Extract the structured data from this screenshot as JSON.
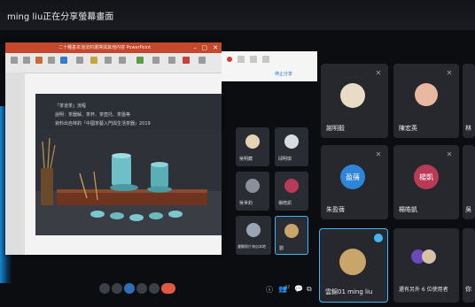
{
  "banner": {
    "text": "ming liu正在分享螢幕畫面"
  },
  "ppt": {
    "title": "二十種基本泡法的選擇與其他內容 PowerPoint",
    "slide": {
      "line1": "「茶道茶」流程",
      "line2": "說明：茶器解、茶杯、茶壺托、茶盤等",
      "line3": "資料出自林鈞『中國茶藝入門與生活茶器』2019"
    }
  },
  "share": {
    "stop_label": "停止分享"
  },
  "mid_tiles": [
    {
      "name": "吳明藏"
    },
    {
      "name": "邱明琪"
    },
    {
      "name": "吳世鈞"
    },
    {
      "name": "石峯源"
    },
    {
      "name": "盈倩"
    },
    {
      "name": "楊皓凱"
    },
    {
      "name": "盧顯照片來自本地"
    },
    {
      "name": "劉"
    }
  ],
  "tiles": [
    {
      "name": "謝明毅"
    },
    {
      "name": "陳宏英"
    },
    {
      "name": "林"
    },
    {
      "name": "朱盈蒨",
      "initials": "盈蒨",
      "color": "#2f86d8"
    },
    {
      "name": "楊皓凱",
      "initials": "楊凱",
      "color": "#b83a57"
    },
    {
      "name": "吳"
    },
    {
      "name": "雲錦01 ming liu"
    },
    {
      "name": "還有另外 6 位使用者"
    },
    {
      "name": "你"
    }
  ],
  "toolbar": {
    "icons": [
      "mic-icon",
      "camera-icon",
      "cc-icon",
      "hand-icon",
      "present-icon",
      "end-call-icon"
    ],
    "side_icons": [
      "info-icon",
      "people-icon",
      "chat-icon",
      "activities-icon"
    ],
    "people_count": "17"
  },
  "colors": {
    "accent": "#3fb7ff",
    "end_call": "#e05a43",
    "mic_off_bg": "#3b3f47"
  }
}
